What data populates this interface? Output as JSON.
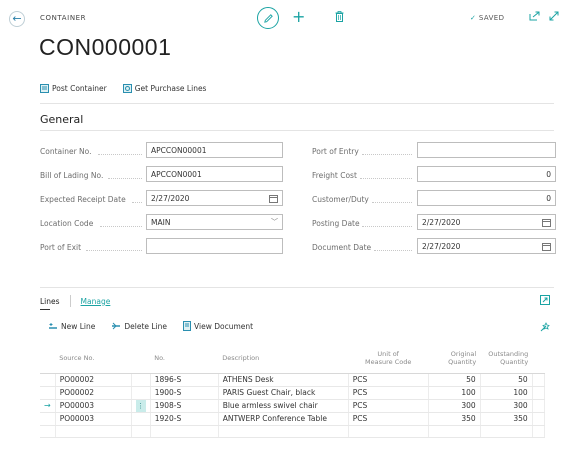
{
  "header": {
    "caption": "CONTAINER",
    "title": "CON000001",
    "saved_label": "SAVED",
    "saved_check": "✓"
  },
  "actions": {
    "post_container": "Post Container",
    "get_purchase_lines": "Get Purchase Lines"
  },
  "general": {
    "title": "General",
    "left": [
      {
        "label": "Container No.",
        "value": ""
      },
      {
        "label": "Bill of Lading No.",
        "value": ""
      },
      {
        "label": "Expected Receipt Date",
        "value": ""
      },
      {
        "label": "Location Code",
        "value": ""
      },
      {
        "label": "Port of Exit",
        "value": ""
      }
    ],
    "container_no": {
      "label": "Container No.",
      "value": "APCCON00001"
    },
    "bill_of_lading": {
      "label": "Bill of Lading No.",
      "value": "APCCON0001"
    },
    "expected_receipt": {
      "label": "Expected Receipt Date",
      "value": "2/27/2020"
    },
    "location_code": {
      "label": "Location Code",
      "value": "MAIN"
    },
    "port_of_exit": {
      "label": "Port of Exit",
      "value": ""
    },
    "port_of_entry": {
      "label": "Port of Entry",
      "value": ""
    },
    "freight_cost": {
      "label": "Freight Cost",
      "value": "0"
    },
    "customer_duty": {
      "label": "Customer/Duty",
      "value": "0"
    },
    "posting_date": {
      "label": "Posting Date",
      "value": "2/27/2020"
    },
    "document_date": {
      "label": "Document Date",
      "value": "2/27/2020"
    }
  },
  "lines": {
    "tab_lines": "Lines",
    "tab_manage": "Manage",
    "new_line": "New Line",
    "delete_line": "Delete Line",
    "view_document": "View Document",
    "columns": {
      "source_no": "Source No.",
      "no": "No.",
      "description": "Description",
      "uom_1": "Unit of",
      "uom_2": "Measure Code",
      "orig_1": "Original",
      "orig_2": "Quantity",
      "out_1": "Outstanding",
      "out_2": "Quantity"
    },
    "rows": [
      {
        "source_no": "PO00002",
        "no": "1896-S",
        "description": "ATHENS Desk",
        "uom": "PCS",
        "original": "50",
        "outstanding": "50"
      },
      {
        "source_no": "PO00002",
        "no": "1900-S",
        "description": "PARIS Guest Chair, black",
        "uom": "PCS",
        "original": "100",
        "outstanding": "100"
      },
      {
        "source_no": "PO00003",
        "no": "1908-S",
        "description": "Blue armless swivel chair",
        "uom": "PCS",
        "original": "300",
        "outstanding": "300"
      },
      {
        "source_no": "PO00003",
        "no": "1920-S",
        "description": "ANTWERP Conference Table",
        "uom": "PCS",
        "original": "350",
        "outstanding": "350"
      }
    ],
    "current_row_marker": "→",
    "row_menu": "⋮"
  },
  "colors": {
    "accent": "#1aa3a3",
    "border": "#bdbdbd"
  },
  "icons": [
    "back-arrow-icon",
    "edit-icon",
    "plus-icon",
    "delete-icon",
    "share-icon",
    "expand-icon",
    "post-icon",
    "purchase-lines-icon",
    "new-line-icon",
    "delete-line-icon",
    "view-document-icon",
    "calendar-icon",
    "chevron-down-icon",
    "open-in-window-icon",
    "personalize-icon"
  ]
}
